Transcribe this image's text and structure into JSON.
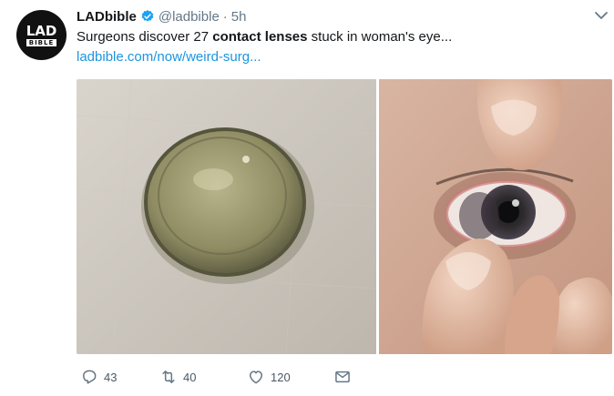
{
  "tweet": {
    "author": {
      "name": "LADbible",
      "handle": "@ladbible",
      "separator": "·",
      "time": "5h",
      "verified": true
    },
    "avatar": {
      "line1": "LAD",
      "line2": "BIBLE"
    },
    "text_parts": [
      "Surgeons discover 27 ",
      "contact lenses",
      " stuck in woman's eye..."
    ],
    "link": "ladbible.com/now/weird-surg...",
    "actions": {
      "replies": "43",
      "retweets": "40",
      "likes": "120"
    }
  },
  "colors": {
    "accent": "#1b95e0",
    "muted": "#657786",
    "verified": "#1da1f2"
  },
  "icons": [
    "verified-badge-icon",
    "chevron-down-icon",
    "reply-icon",
    "retweet-icon",
    "like-icon",
    "direct-message-icon"
  ]
}
